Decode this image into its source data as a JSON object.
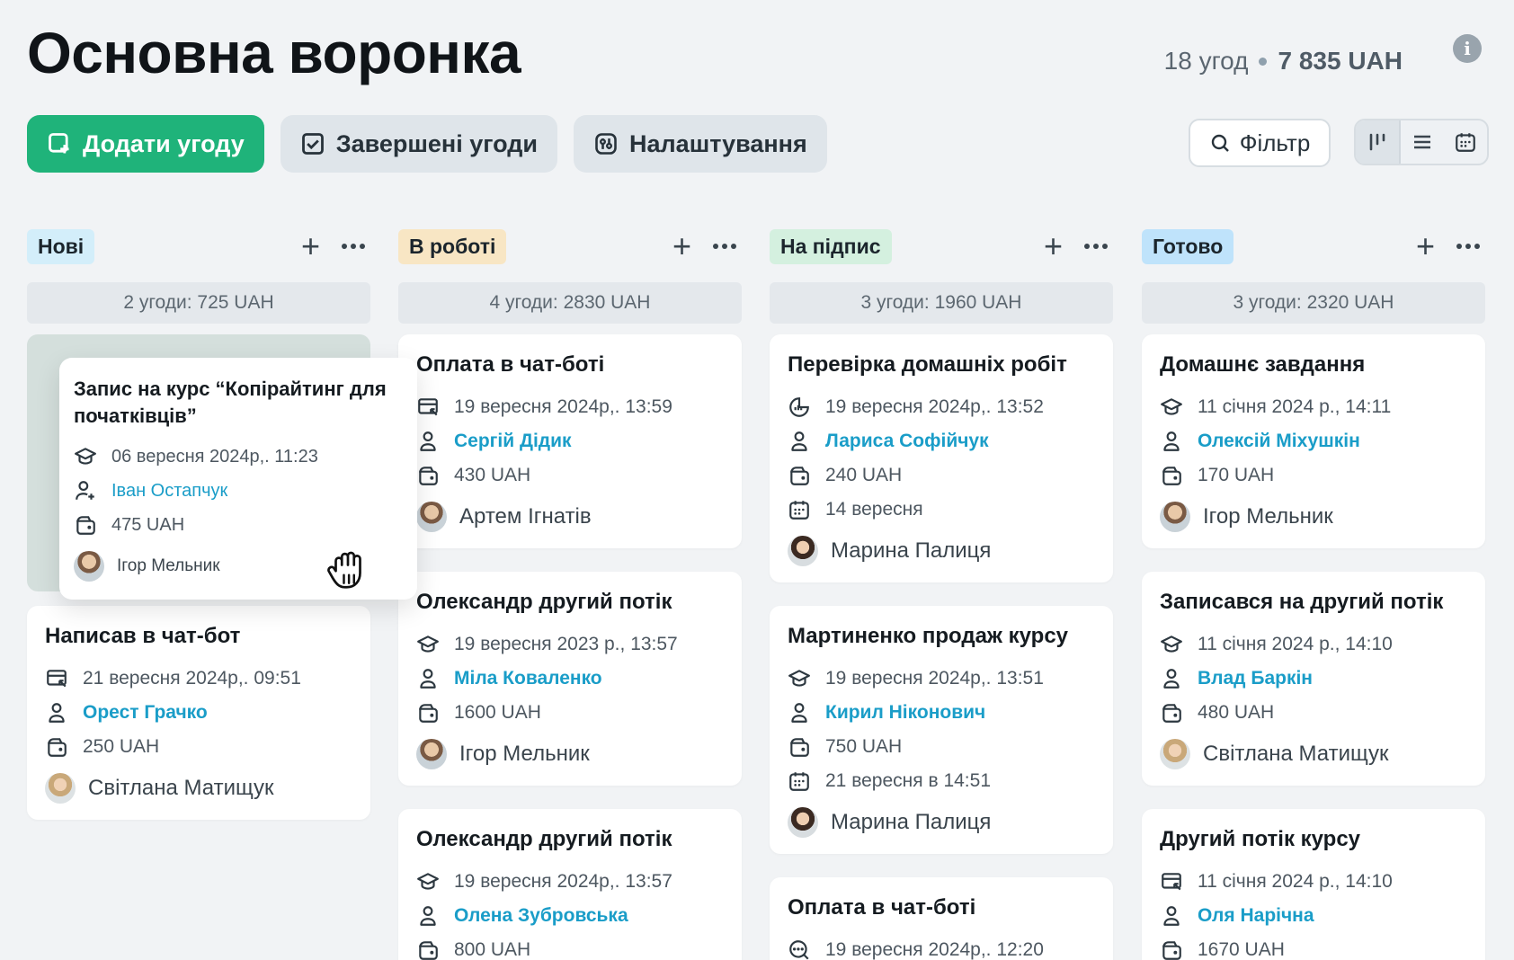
{
  "header": {
    "title": "Основна воронка",
    "deals_count": "18 угод",
    "total": "7 835 UAH"
  },
  "toolbar": {
    "add_deal": "Додати угоду",
    "completed_deals": "Завершені угоди",
    "settings": "Налаштування",
    "filter": "Фільтр"
  },
  "colors": {
    "primary": "#1fb37a",
    "link": "#1a9dc8",
    "tag_new": "#d3eefa",
    "tag_in_work": "#f8e6c4",
    "tag_signing": "#d4f0df",
    "tag_done": "#bfe3fb"
  },
  "columns": [
    {
      "title": "Нові",
      "summary": "2 угоди: 725 UAH",
      "cards": [
        {
          "title": "Написав в чат-бот",
          "date": "21 вересня 2024р,. 09:51",
          "contact": "Орест Грачко",
          "amount": "250 UAH",
          "owner": "Світлана Матищук",
          "icon": "chat-transfer-icon"
        }
      ]
    },
    {
      "title": "В роботі",
      "summary": "4 угоди: 2830 UAH",
      "cards": [
        {
          "title": "Оплата в чат-боті",
          "date": "19 вересня 2024р,. 13:59",
          "contact": "Сергій Дідик",
          "amount": "430 UAH",
          "owner": "Артем Ігнатів"
        },
        {
          "title": "Олександр другий потік",
          "date": "19 вересня 2023 р., 13:57",
          "contact": "Міла Коваленко",
          "amount": "1600 UAH",
          "owner": "Ігор Мельник"
        },
        {
          "title": "Олександр другий потік",
          "date": "19 вересня 2024р,. 13:57",
          "contact": "Олена Зубровська",
          "amount": "800 UAH"
        }
      ]
    },
    {
      "title": "На підпис",
      "summary": "3 угоди: 1960 UAH",
      "cards": [
        {
          "title": "Перевірка домашніх робіт",
          "date": "19 вересня 2024р,. 13:52",
          "contact": "Лариса Софійчук",
          "amount": "240 UAH",
          "deadline": "14 вересня",
          "owner": "Марина Палиця"
        },
        {
          "title": "Мартиненко продаж курсу",
          "date": "19 вересня 2024р,. 13:51",
          "contact": "Кирил Ніконович",
          "amount": "750 UAH",
          "deadline": "21 вересня в 14:51",
          "owner": "Марина Палиця"
        },
        {
          "title": "Оплата в чат-боті",
          "date": "19 вересня 2024р,. 12:20"
        }
      ]
    },
    {
      "title": "Готово",
      "summary": "3 угоди: 2320 UAH",
      "cards": [
        {
          "title": "Домашнє завдання",
          "date": "11 січня 2024 р., 14:11",
          "contact": "Олексій Міхушкін",
          "amount": "170 UAH",
          "owner": "Ігор Мельник"
        },
        {
          "title": "Записався на другий потік",
          "date": "11 січня 2024 р., 14:10",
          "contact": "Влад Баркін",
          "amount": "480 UAH",
          "owner": "Світлана Матищук"
        },
        {
          "title": "Другий потік курсу",
          "date": "11 січня 2024 р., 14:10",
          "contact": "Оля Нарічна",
          "amount": "1670 UAH"
        }
      ]
    }
  ],
  "dragging_card": {
    "title": "Запис на курс “Копірайтинг для початківців”",
    "date": "06 вересня 2024р,. 11:23",
    "contact": "Іван Остапчук",
    "amount": "475 UAH",
    "owner": "Ігор Мельник"
  }
}
